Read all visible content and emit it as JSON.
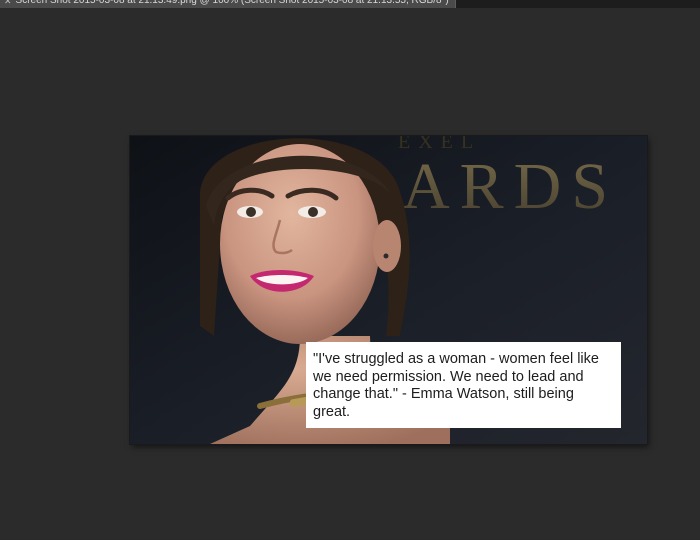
{
  "window": {
    "tab_title": "Screen Shot 2015-03-08 at 21.13.49.png @ 100% (Screen Shot 2015-03-08 at 21.13.55, RGB/8*)"
  },
  "canvas": {
    "backdrop_text": "ARDS",
    "quote": "\"I've struggled as a woman - women feel like we need permission. We need to lead and change that.\" - Emma Watson, still being great."
  },
  "colors": {
    "workspace": "#2b2b2b",
    "tab": "#4a4a4a",
    "quote_box": "#ffffff"
  },
  "icons": {
    "tab_close": "close-icon"
  }
}
